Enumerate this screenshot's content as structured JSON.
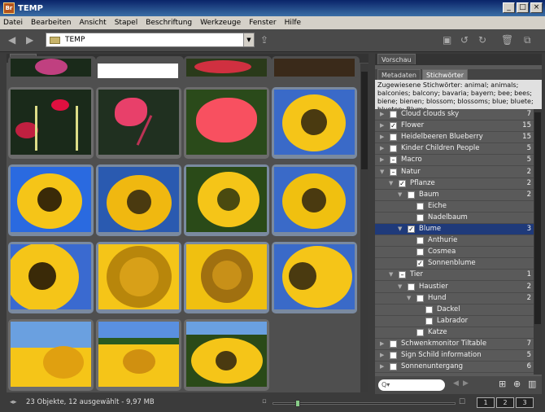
{
  "app": {
    "logo": "Br",
    "title": "TEMP"
  },
  "menu": [
    "Datei",
    "Bearbeiten",
    "Ansicht",
    "Stapel",
    "Beschriftung",
    "Werkzeuge",
    "Fenster",
    "Hilfe"
  ],
  "path": {
    "value": "TEMP"
  },
  "content": {
    "tab": "Inhalt"
  },
  "panels": {
    "preview": "Vorschau",
    "metadata": "Metadaten",
    "keywords": "Stichwörter"
  },
  "hint": "Zugewiesene Stichwörter: animal; animals; balconies; balcony; bavaria; bayern; bee; bees; biene; bienen; blossom; blossoms; blue; bluete; blueten; Blume",
  "keywords": [
    {
      "label": "Cloud clouds sky",
      "count": "7",
      "level": 0,
      "tri": "▶",
      "check": ""
    },
    {
      "label": "Flower",
      "count": "15",
      "level": 0,
      "tri": "▶",
      "check": "✓"
    },
    {
      "label": "Heidelbeeren Blueberry",
      "count": "15",
      "level": 0,
      "tri": "▶",
      "check": ""
    },
    {
      "label": "Kinder Children People",
      "count": "5",
      "level": 0,
      "tri": "▶",
      "check": ""
    },
    {
      "label": "Macro",
      "count": "5",
      "level": 0,
      "tri": "▶",
      "check": "–"
    },
    {
      "label": "Natur",
      "count": "2",
      "level": 0,
      "tri": "▼",
      "check": "–"
    },
    {
      "label": "Pflanze",
      "count": "2",
      "level": 1,
      "tri": "▼",
      "check": "✓"
    },
    {
      "label": "Baum",
      "count": "2",
      "level": 2,
      "tri": "▼",
      "check": ""
    },
    {
      "label": "Eiche",
      "count": "",
      "level": 3,
      "tri": "",
      "check": ""
    },
    {
      "label": "Nadelbaum",
      "count": "",
      "level": 3,
      "tri": "",
      "check": ""
    },
    {
      "label": "Blume",
      "count": "3",
      "level": 2,
      "tri": "▼",
      "check": "✓"
    },
    {
      "label": "Anthurie",
      "count": "",
      "level": 3,
      "tri": "",
      "check": ""
    },
    {
      "label": "Cosmea",
      "count": "",
      "level": 3,
      "tri": "",
      "check": ""
    },
    {
      "label": "Sonnenblume",
      "count": "",
      "level": 3,
      "tri": "",
      "check": "✓"
    },
    {
      "label": "Tier",
      "count": "1",
      "level": 1,
      "tri": "▼",
      "check": "–"
    },
    {
      "label": "Haustier",
      "count": "2",
      "level": 2,
      "tri": "▼",
      "check": ""
    },
    {
      "label": "Hund",
      "count": "2",
      "level": 3,
      "tri": "▼",
      "check": ""
    },
    {
      "label": "Dackel",
      "count": "",
      "level": 4,
      "tri": "",
      "check": ""
    },
    {
      "label": "Labrador",
      "count": "",
      "level": 4,
      "tri": "",
      "check": ""
    },
    {
      "label": "Katze",
      "count": "",
      "level": 3,
      "tri": "",
      "check": ""
    },
    {
      "label": "Schwenkmonitor Tiltable",
      "count": "7",
      "level": 0,
      "tri": "▶",
      "check": ""
    },
    {
      "label": "Sign Schild information",
      "count": "5",
      "level": 0,
      "tri": "▶",
      "check": ""
    },
    {
      "label": "Sonnenuntergang",
      "count": "6",
      "level": 0,
      "tri": "▶",
      "check": ""
    }
  ],
  "search": {
    "placeholder": "Q▾"
  },
  "status": {
    "text": "23 Objekte, 12 ausgewählt - 9,97 MB",
    "zoom_level": 0.12
  },
  "view_buttons": [
    "1",
    "2",
    "3"
  ]
}
